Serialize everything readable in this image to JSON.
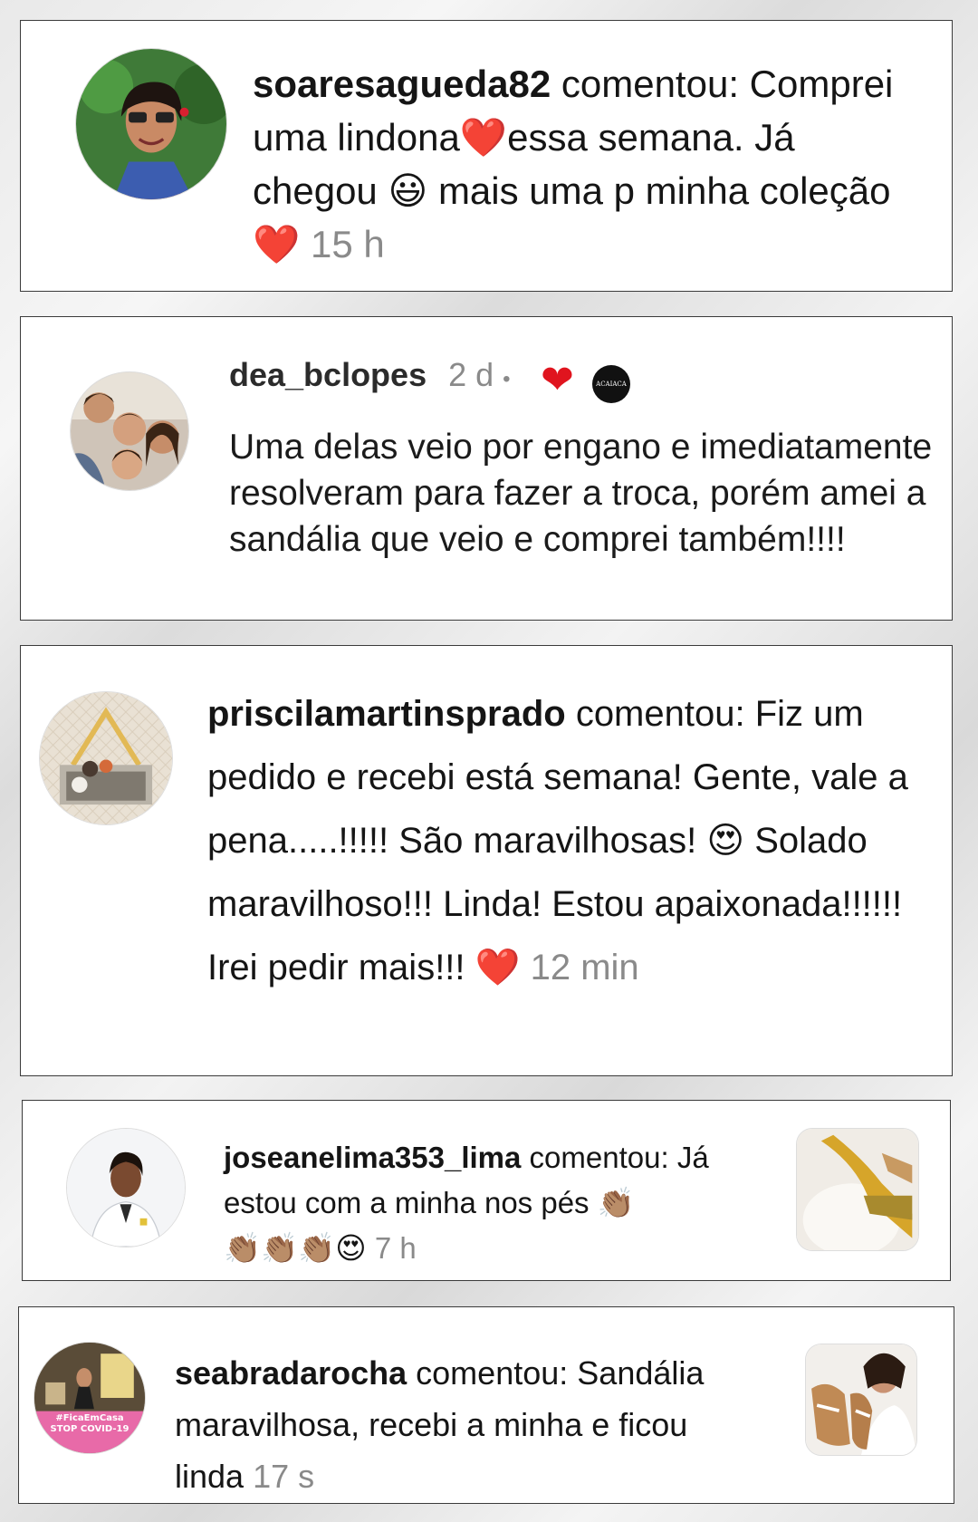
{
  "comments": [
    {
      "username": "soaresagueda82",
      "verb": "comentou:",
      "text_1": "Comprei uma lindona",
      "emoji_1": "❤️",
      "text_2": "essa semana. Já chegou",
      "emoji_2": "😃",
      "text_3": "mais uma p minha coleção",
      "emoji_3": "❤️",
      "time": "15 h"
    },
    {
      "username": "dea_bclopes",
      "time": "2 d",
      "dot": "•",
      "liked_heart": "❤",
      "creator_badge_text": "ACAIACA",
      "text": "Uma delas veio por engano e imediatamente resolveram para fazer a troca, porém amei a sandália que veio e comprei também!!!!"
    },
    {
      "username": "priscilamartinsprado",
      "verb": "comentou:",
      "text_1": "Fiz um pedido e recebi está semana! Gente, vale a pena.....!!!!! São maravilhosas!",
      "emoji_1": "😍",
      "text_2": "Solado maravilhoso!!! Linda! Estou apaixonada!!!!!! Irei pedir mais!!!",
      "emoji_2": "❤️",
      "time": "12 min"
    },
    {
      "username": "joseanelima353_lima",
      "verb": "comentou:",
      "text_1": "Já estou com a minha nos pés",
      "emoji_1": "👏🏽",
      "emoji_2": "👏🏽👏🏽👏🏽😍",
      "time": "7 h"
    },
    {
      "username": "seabradarocha",
      "verb": "comentou:",
      "text_1": "Sandália maravilhosa, recebi a minha e ficou linda",
      "time": "17 s",
      "avatar_badge_line_1": "#FicaEmCasa",
      "avatar_badge_line_2": "STOP COVID-19"
    }
  ],
  "colors": {
    "heart": "#e0141e",
    "timestamp": "#8a8a8a",
    "card_border": "#3b3b3b",
    "badge_pink": "#e86aa8"
  }
}
